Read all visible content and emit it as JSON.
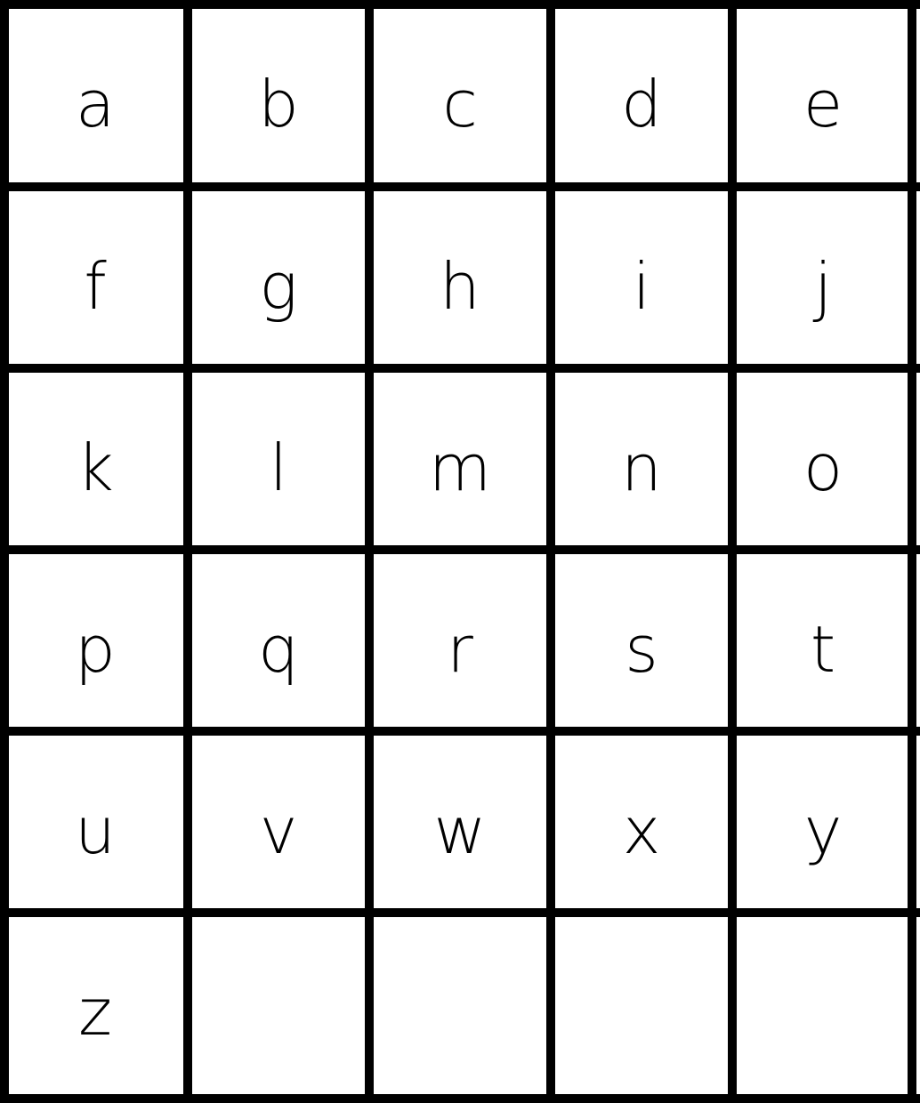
{
  "letters": [
    [
      "a",
      "b",
      "c",
      "d",
      "e"
    ],
    [
      "f",
      "g",
      "h",
      "i",
      "j"
    ],
    [
      "k",
      "l",
      "m",
      "n",
      "o"
    ],
    [
      "p",
      "q",
      "r",
      "s",
      "t"
    ],
    [
      "u",
      "v",
      "w",
      "x",
      "y"
    ],
    [
      "z",
      "",
      "",
      "",
      ""
    ]
  ]
}
